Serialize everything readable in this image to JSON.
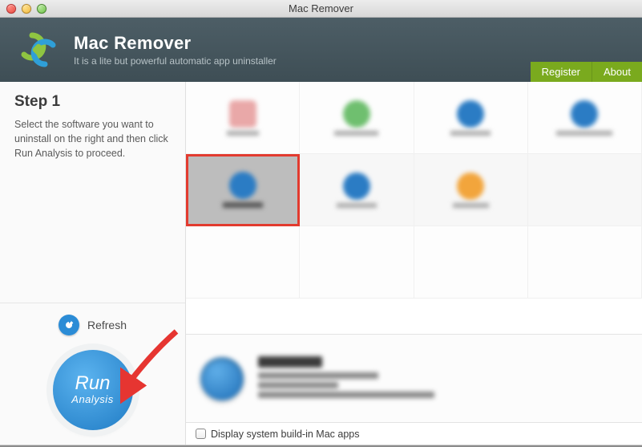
{
  "window": {
    "title": "Mac Remover"
  },
  "header": {
    "app_title": "Mac Remover",
    "subtitle": "It is a lite but powerful automatic app uninstaller",
    "register_label": "Register",
    "about_label": "About"
  },
  "sidebar": {
    "step_title": "Step 1",
    "step_desc": "Select the software you want to uninstall on the right and then click Run Analysis to proceed.",
    "refresh_label": "Refresh",
    "run_top": "Run",
    "run_bottom": "Analysis"
  },
  "grid": {
    "selected_index": 4
  },
  "footer": {
    "checkbox_label": "Display system build-in Mac apps",
    "checked": false
  },
  "annotation": {
    "arrow_target": "run-analysis-button"
  }
}
